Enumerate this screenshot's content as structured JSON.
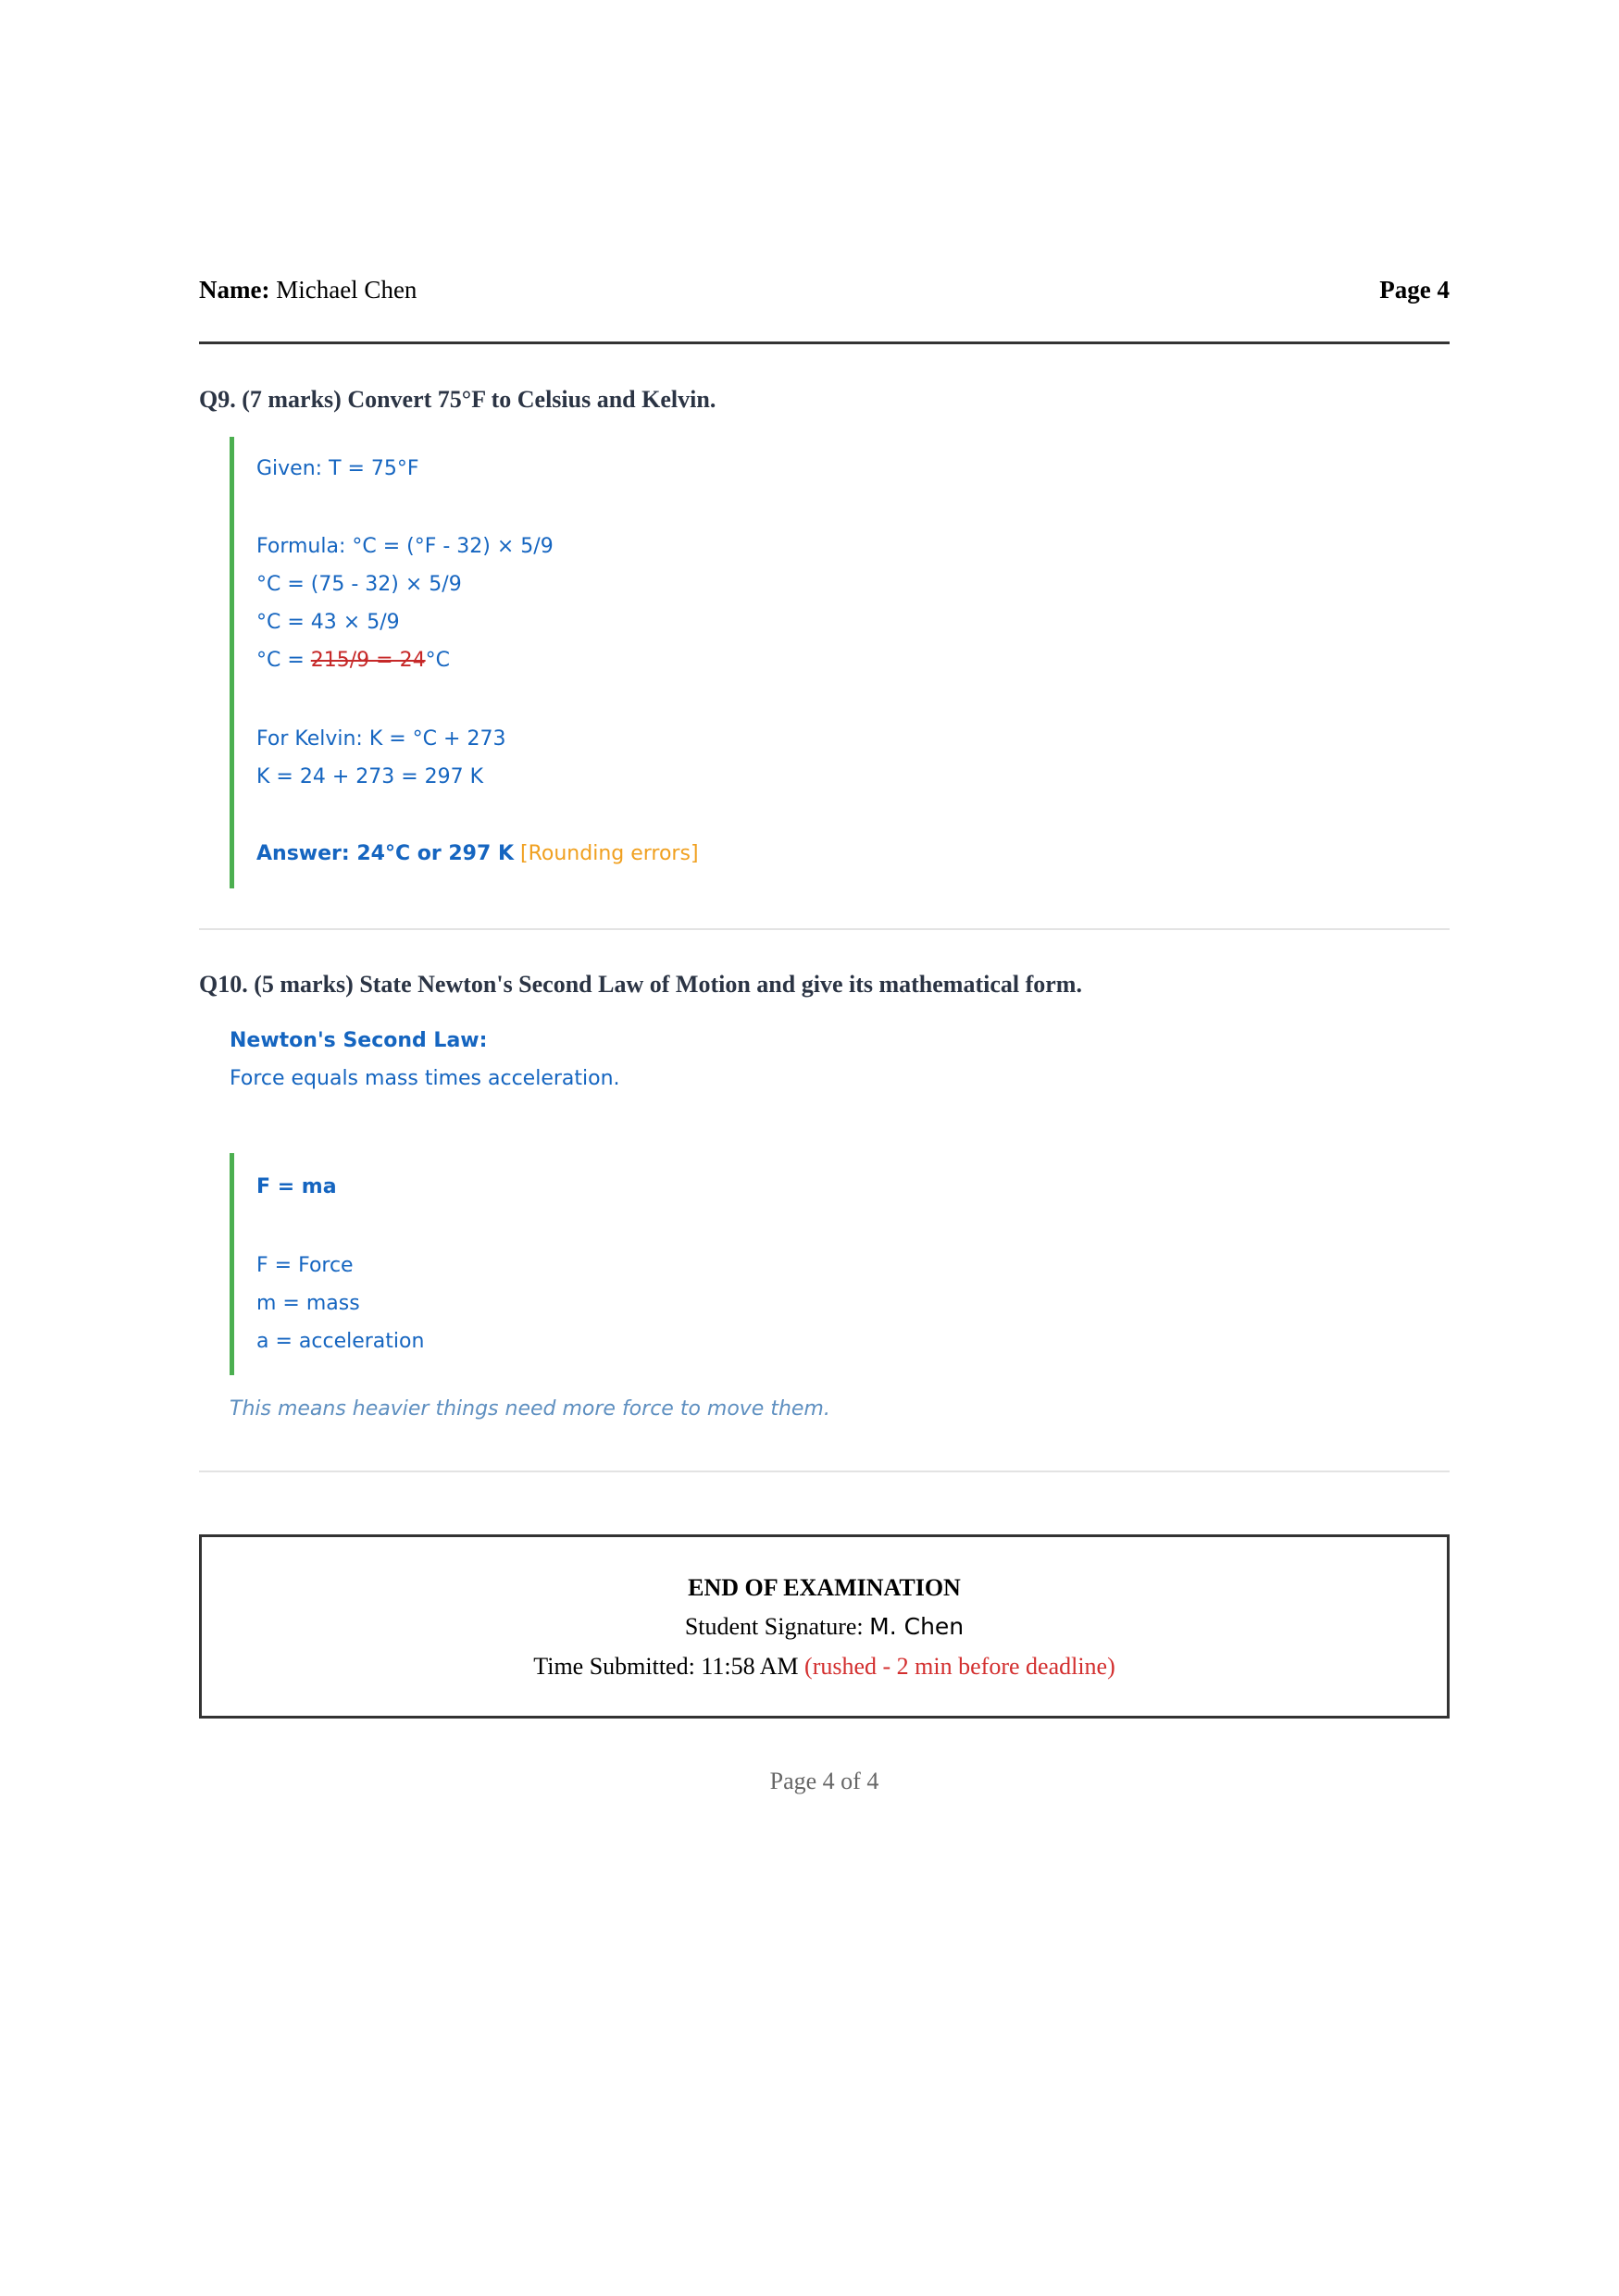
{
  "header": {
    "name_label": "Name:",
    "name_value": "Michael Chen",
    "page_label": "Page 4"
  },
  "q9": {
    "question": "Q9. (7 marks) Convert 75°F to Celsius and Kelvin.",
    "given": "Given: T = 75°F",
    "formula": "Formula: °C = (°F - 32) × 5/9",
    "step1": "°C = (75 - 32) × 5/9",
    "step2": "°C = 43 × 5/9",
    "step3_prefix": "°C = ",
    "step3_struck": "215/9 = 24",
    "step3_suffix": "°C",
    "kelvin_formula": "For Kelvin: K = °C + 273",
    "kelvin_calc": "K = 24 + 273 = 297 K",
    "answer": "Answer: 24°C or 297 K",
    "grader_note": "[Rounding errors]"
  },
  "q10": {
    "question": "Q10. (5 marks) State Newton's Second Law of Motion and give its mathematical form.",
    "law_title": "Newton's Second Law:",
    "law_text": "Force equals mass times acceleration.",
    "equation": "F = ma",
    "def_f": "F = Force",
    "def_m": "m = mass",
    "def_a": "a = acceleration",
    "note": "This means heavier things need more force to move them."
  },
  "end": {
    "title": "END OF EXAMINATION",
    "signature_label": "Student Signature: ",
    "signature_value": "M. Chen",
    "time_label": "Time Submitted: 11:58 AM ",
    "time_note": "(rushed - 2 min before deadline)"
  },
  "footer": {
    "page_of": "Page 4 of 4"
  }
}
